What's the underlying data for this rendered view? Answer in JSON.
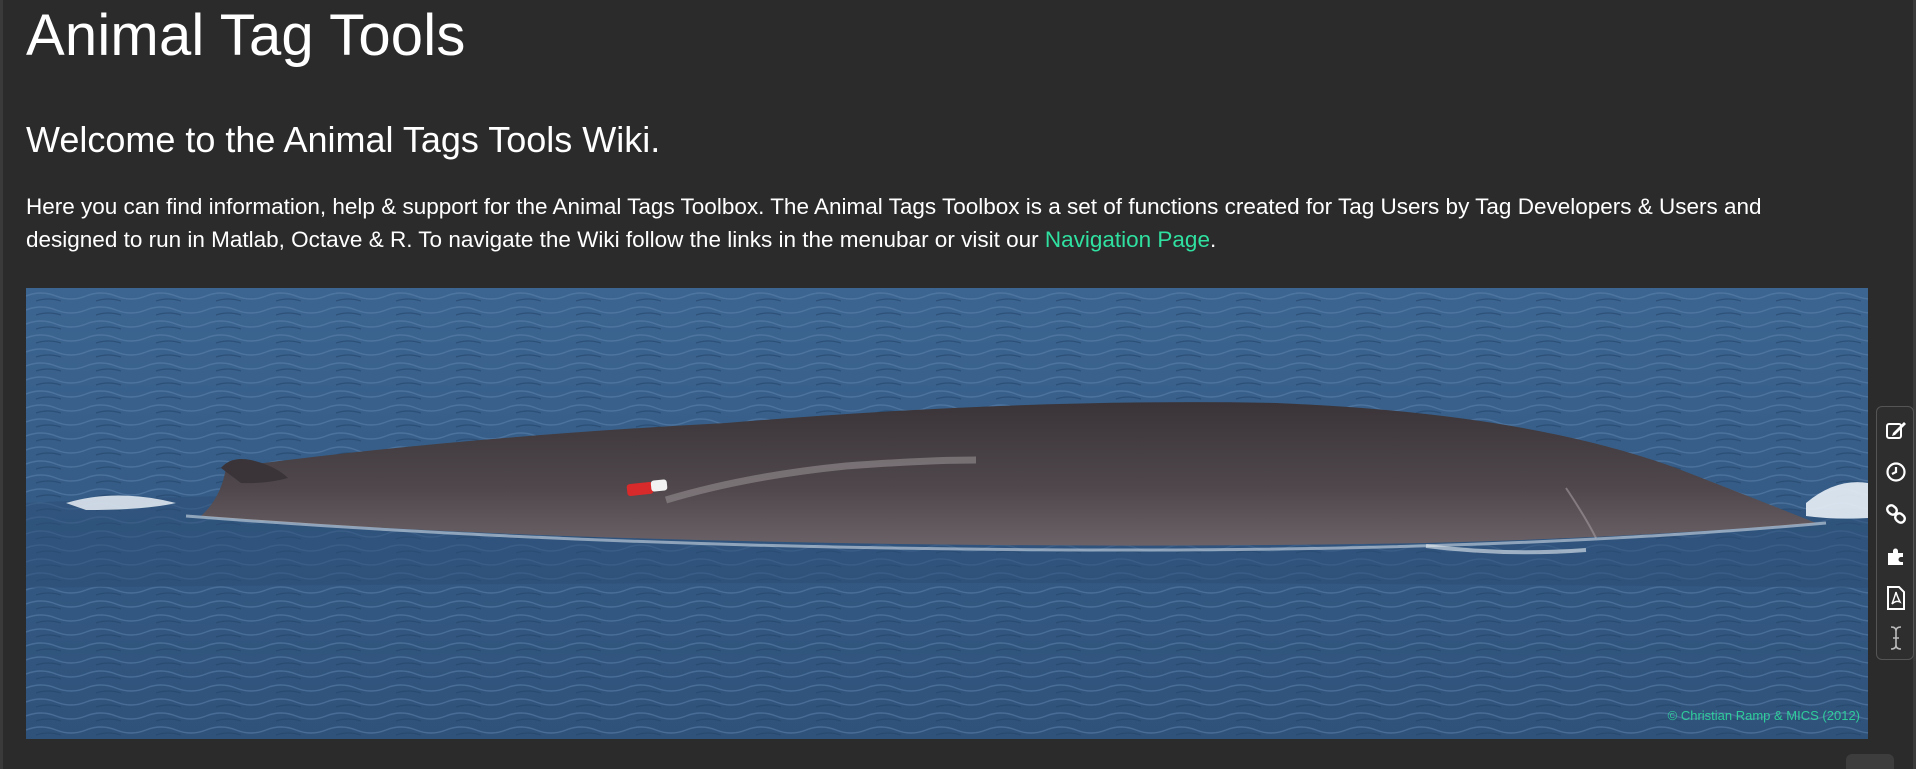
{
  "page": {
    "title": "Animal Tag Tools",
    "welcome": "Welcome to the Animal Tags Tools Wiki.",
    "intro_text": "Here you can find information, help & support for the Animal Tags Toolbox. The Animal Tags Toolbox is a set of functions created for Tag Users by Tag Developers & Users and designed to run in Matlab, Octave & R. To navigate the Wiki follow the links in the menubar or visit our ",
    "intro_link": "Navigation Page",
    "intro_end": "."
  },
  "photo": {
    "credit": "© Christian Ramp & MICS (2012)"
  },
  "toolbar": {
    "items": [
      {
        "name": "edit-icon"
      },
      {
        "name": "history-icon"
      },
      {
        "name": "link-icon"
      },
      {
        "name": "plugin-icon"
      },
      {
        "name": "pdf-icon"
      },
      {
        "name": "text-cursor-icon"
      }
    ]
  },
  "colors": {
    "background": "#2b2b2b",
    "link": "#2fe0a0",
    "text": "#ffffff",
    "sea": "#365a85",
    "whale": "#4a4347"
  }
}
